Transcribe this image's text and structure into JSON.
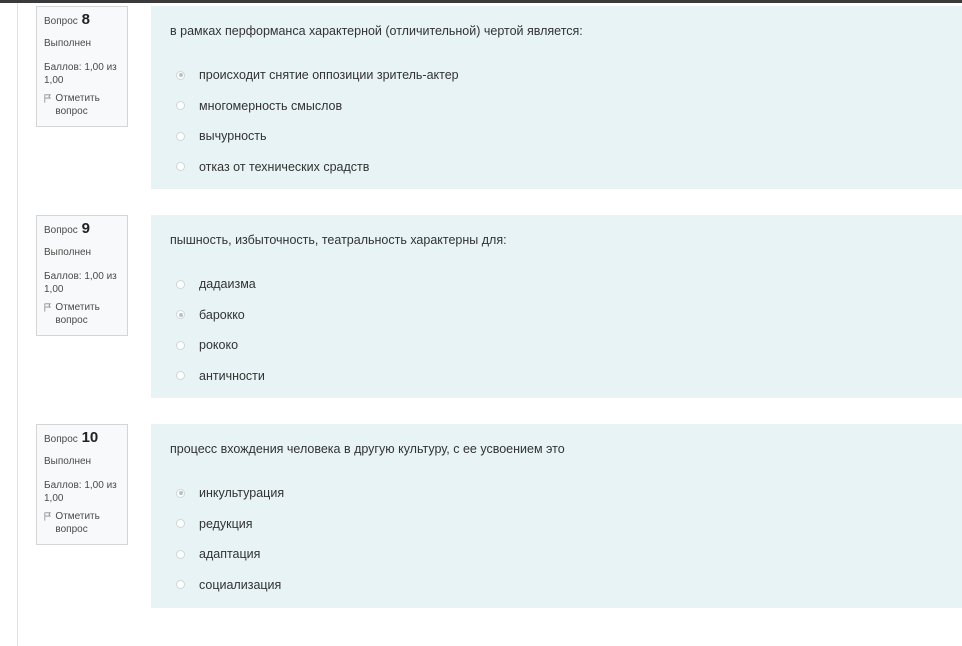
{
  "questions": [
    {
      "label": "Вопрос",
      "number": "8",
      "state": "Выполнен",
      "grade": "Баллов: 1,00 из 1,00",
      "flag": "Отметить вопрос",
      "text": "в рамках перформанса характерной (отличительной) чертой является:",
      "answers": [
        {
          "label": "происходит снятие оппозиции зритель-актер",
          "checked": true
        },
        {
          "label": "многомерность смыслов",
          "checked": false
        },
        {
          "label": "вычурность",
          "checked": false
        },
        {
          "label": "отказ от технических срадств",
          "checked": false
        }
      ]
    },
    {
      "label": "Вопрос",
      "number": "9",
      "state": "Выполнен",
      "grade": "Баллов: 1,00 из 1,00",
      "flag": "Отметить вопрос",
      "text": "пышность, избыточность, театральность характерны для:",
      "answers": [
        {
          "label": "дадаизма",
          "checked": false
        },
        {
          "label": "барокко",
          "checked": true
        },
        {
          "label": "рококо",
          "checked": false
        },
        {
          "label": "античности",
          "checked": false
        }
      ]
    },
    {
      "label": "Вопрос",
      "number": "10",
      "state": "Выполнен",
      "grade": "Баллов: 1,00 из 1,00",
      "flag": "Отметить вопрос",
      "text": "процесс вхождения человека в другую культуру, с ее усвоением это",
      "answers": [
        {
          "label": "инкультурация",
          "checked": true
        },
        {
          "label": "редукция",
          "checked": false
        },
        {
          "label": "адаптация",
          "checked": false
        },
        {
          "label": "социализация",
          "checked": false
        }
      ]
    }
  ]
}
